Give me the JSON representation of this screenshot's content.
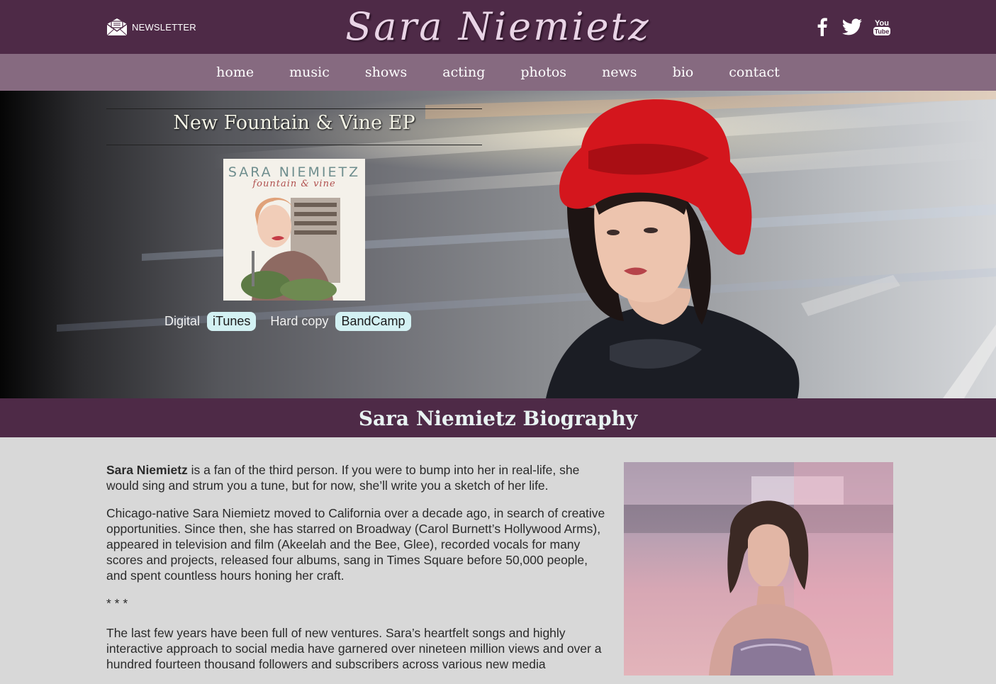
{
  "header": {
    "newsletter_label": "NEWSLETTER",
    "site_title": "Sara Niemietz",
    "social": [
      {
        "icon": "facebook-icon",
        "label": "f"
      },
      {
        "icon": "twitter-icon"
      },
      {
        "icon": "youtube-icon",
        "label_top": "You",
        "label_bottom": "Tube"
      }
    ]
  },
  "nav": {
    "items": [
      "home",
      "music",
      "shows",
      "acting",
      "photos",
      "news",
      "bio",
      "contact"
    ]
  },
  "hero": {
    "ep_title": "New Fountain & Vine EP",
    "cover": {
      "artist": "SARA NIEMIETZ",
      "album": "fountain & vine"
    },
    "digital_label": "Digital",
    "itunes_label": "iTunes",
    "hardcopy_label": "Hard copy",
    "bandcamp_label": "BandCamp"
  },
  "section": {
    "title": "Sara Niemietz Biography"
  },
  "bio": {
    "p1_name": "Sara Niemietz",
    "p1_rest": " is a fan of the third person. If you were to bump into her in real-life, she would sing and strum you a tune, but for now, she’ll write you a sketch of her life.",
    "p2": "Chicago-native Sara Niemietz moved to California over a decade ago, in search of creative opportunities. Since then, she has starred on Broadway (Carol Burnett’s Hollywood Arms), appeared in television and film (Akeelah and the Bee, Glee), recorded vocals for many scores and projects, released four albums, sang in Times Square before 50,000 people, and spent countless hours honing her craft.",
    "separator": "* * *",
    "p3": "The last few years have been full of new ventures. Sara’s heartfelt songs and highly interactive approach to social media have garnered over nineteen million views and over a hundred fourteen thousand followers and subscribers across various new media"
  },
  "colors": {
    "header_bg": "#4e2a47",
    "nav_bg": "#866a80",
    "button_bg": "#d3f1f3",
    "page_bg": "#d8d8d8"
  }
}
